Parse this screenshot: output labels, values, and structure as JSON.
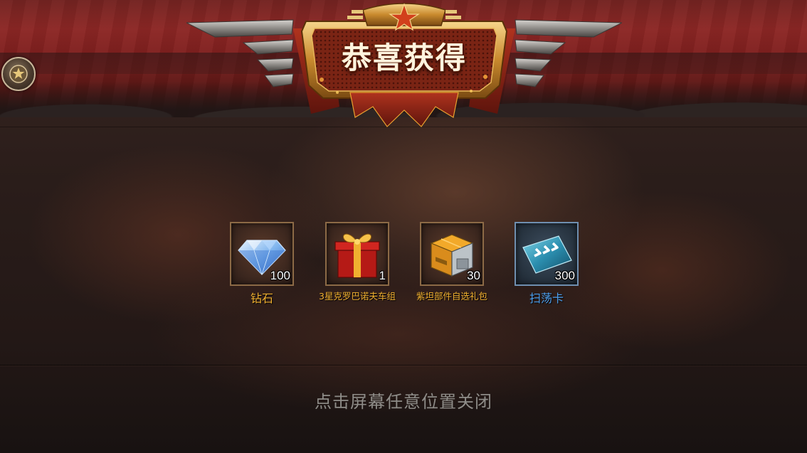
{
  "header": {
    "title": "恭喜获得"
  },
  "rewards": [
    {
      "name": "钻石",
      "count": "100",
      "icon": "diamond-icon",
      "rarity_color": "#f0b030"
    },
    {
      "name": "3星克罗巴诺夫车组",
      "count": "1",
      "icon": "gift-box-icon",
      "rarity_color": "#f0b030"
    },
    {
      "name": "紫坦部件自选礼包",
      "count": "30",
      "icon": "supply-crate-icon",
      "rarity_color": "#f0b030"
    },
    {
      "name": "扫荡卡",
      "count": "300",
      "icon": "sweep-card-icon",
      "rarity_color": "#4da0f0"
    }
  ],
  "footer": {
    "close_hint": "点击屏幕任意位置关闭"
  }
}
